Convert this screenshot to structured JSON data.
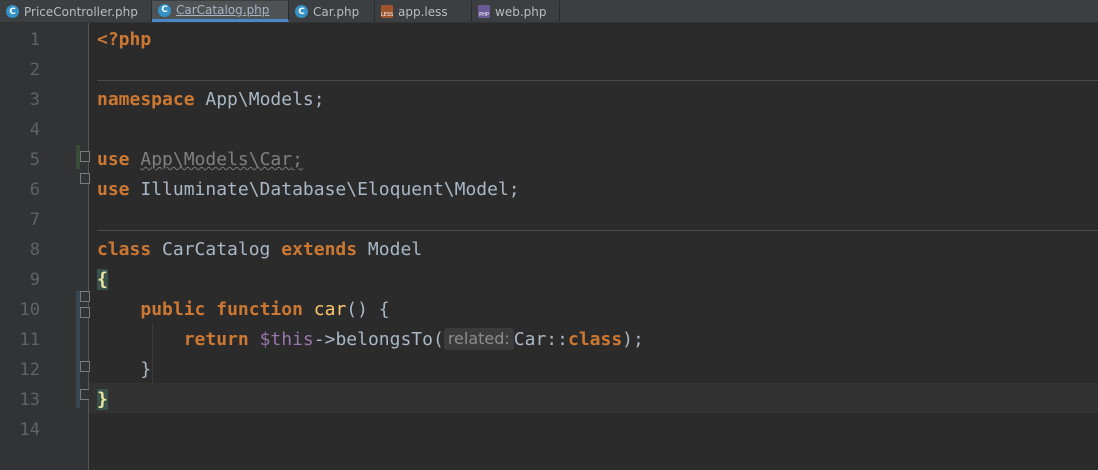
{
  "tabs": [
    {
      "label": "PriceController.php",
      "icon": "php-class-icon",
      "active": false
    },
    {
      "label": "CarCatalog.php",
      "icon": "php-class-icon",
      "active": true
    },
    {
      "label": "Car.php",
      "icon": "php-class-icon",
      "active": false
    },
    {
      "label": "app.less",
      "icon": "less-file-icon",
      "badge": "LESS",
      "active": false
    },
    {
      "label": "web.php",
      "icon": "php-file-icon",
      "badge": "PHP",
      "active": false
    }
  ],
  "line_numbers": [
    "1",
    "2",
    "3",
    "4",
    "5",
    "6",
    "7",
    "8",
    "9",
    "10",
    "11",
    "12",
    "13",
    "14"
  ],
  "code": {
    "l1_tag": "<?php",
    "l3_kw": "namespace",
    "l3_rest": " App\\Models;",
    "l5_kw": "use",
    "l5_ns": "App\\Models\\Car",
    "l5_semi": ";",
    "l6_kw": "use",
    "l6_rest": " Illuminate\\Database\\Eloquent\\Model;",
    "l8_kw1": "class",
    "l8_name": " CarCatalog ",
    "l8_kw2": "extends",
    "l8_rest": " Model",
    "l9_brace": "{",
    "l10_indent": "    ",
    "l10_kw1": "public",
    "l10_sp": " ",
    "l10_kw2": "function",
    "l10_name": " car",
    "l10_rest": "() {",
    "l11_indent": "        ",
    "l11_kw": "return",
    "l11_sp": " ",
    "l11_var": "$this",
    "l11_arrow": "->belongsTo(",
    "l11_hint": "related:",
    "l11_arg": "Car::",
    "l11_class": "class",
    "l11_end": ");",
    "l12_text": "    }",
    "l13_brace": "}"
  }
}
